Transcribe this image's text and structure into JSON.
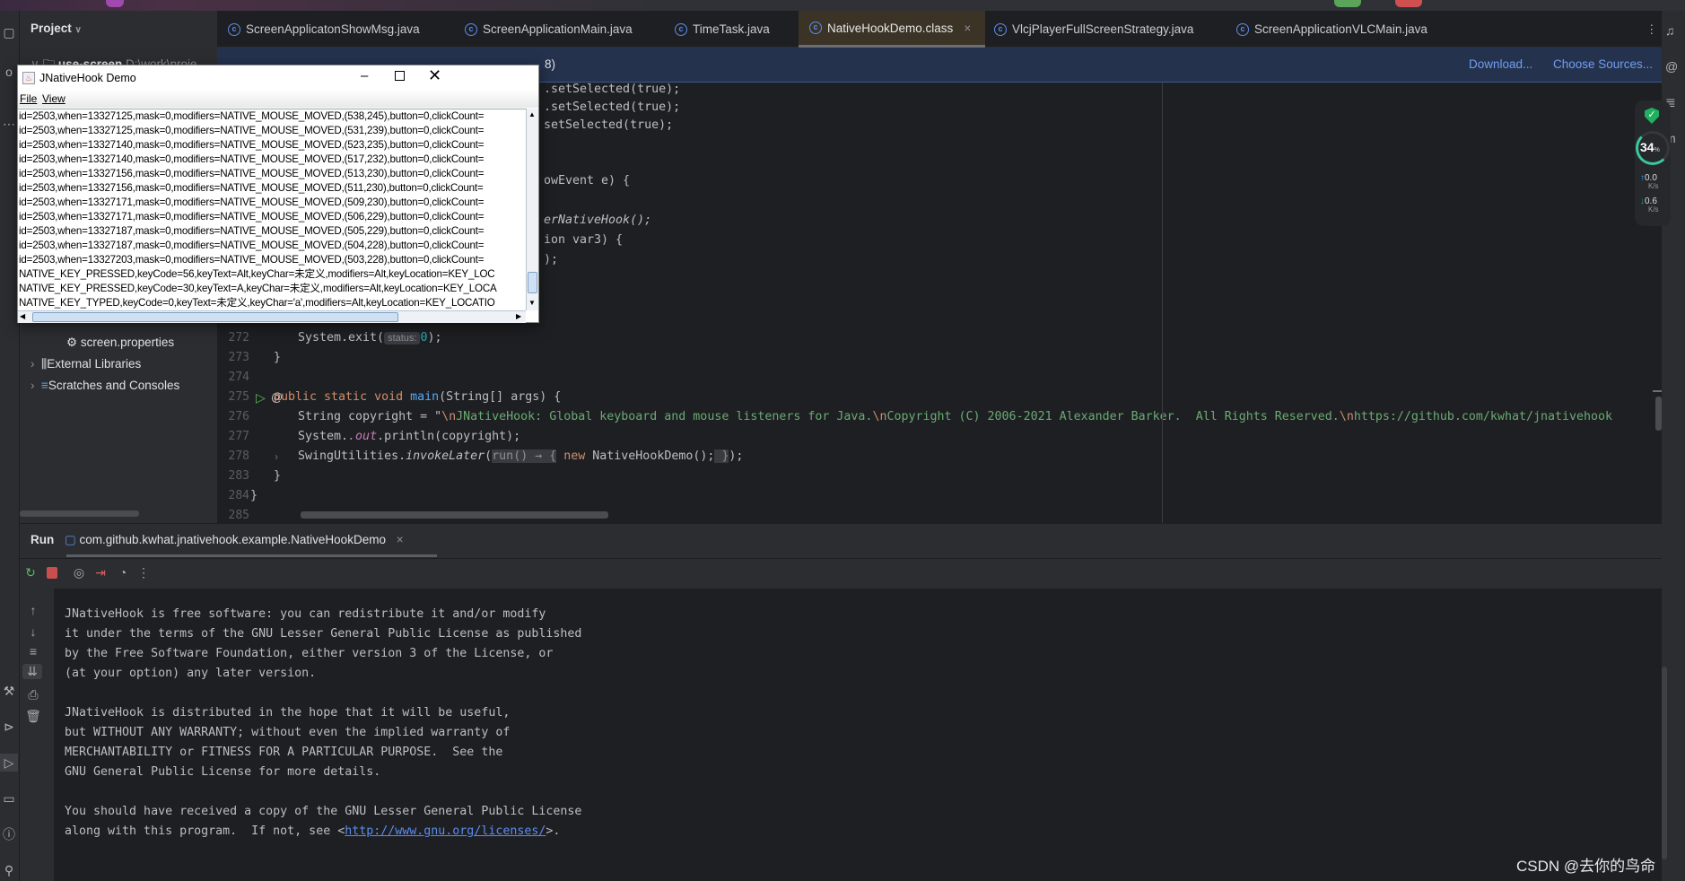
{
  "window": {
    "accent": "#5b8def",
    "editor_bg": "#1e1f22",
    "panel_bg": "#2b2d30"
  },
  "project": {
    "header": "Project",
    "tree": [
      {
        "label": "use-screen",
        "extra": "D:\\work\\proje"
      },
      {
        "label": "screen.properties",
        "icon": "gear-icon"
      },
      {
        "label": "External Libraries",
        "icon": "library-icon"
      },
      {
        "label": "Scratches and Consoles",
        "icon": "scratches-icon"
      }
    ]
  },
  "tabs": [
    {
      "label": "ScreenApplicatonShowMsg.java"
    },
    {
      "label": "ScreenApplicationMain.java"
    },
    {
      "label": "TimeTask.java"
    },
    {
      "label": "NativeHookDemo.class",
      "active": true
    },
    {
      "label": "VlcjPlayerFullScreenStrategy.java"
    },
    {
      "label": "ScreenApplicationVLCMain.java"
    }
  ],
  "notification": {
    "text": "8)",
    "download": "Download...",
    "choose_sources": "Choose Sources..."
  },
  "editor": {
    "partial": [
      ".setSelected(true);",
      ".setSelected(true);",
      "setSelected(true);",
      "owEvent e) {",
      "erNativeHook();",
      "ion var3) {",
      ");"
    ],
    "lines": [
      {
        "n": "272",
        "parts": [
          "System.exit(",
          "status:",
          "0",
          ");"
        ]
      },
      {
        "n": "273",
        "text": "}"
      },
      {
        "n": "274",
        "text": ""
      },
      {
        "n": "275",
        "parts": [
          "public static void ",
          "main",
          "(String[] args) {"
        ]
      },
      {
        "n": "276",
        "parts": [
          "String copyright = \"",
          "\\n",
          "JNativeHook: Global keyboard and mouse listeners for Java.",
          "\\n",
          "Copyright (C) 2006-2021 Alexander Barker.  All Rights Reserved.",
          "\\n",
          "https://github.com/kwhat/jnativehook"
        ]
      },
      {
        "n": "277",
        "parts": [
          "System.",
          ".out",
          ".println(copyright);"
        ]
      },
      {
        "n": "278",
        "parts": [
          "SwingUtilities.",
          "invokeLater",
          "(",
          "run() → {",
          " new",
          " NativeHookDemo();",
          " }",
          ");"
        ]
      },
      {
        "n": "283",
        "text": "}"
      },
      {
        "n": "284",
        "text": "}"
      },
      {
        "n": "285",
        "text": ""
      }
    ]
  },
  "widget": {
    "cpu_percent": 34,
    "percent_sign": "%",
    "upload": "0.0",
    "download": "0.6",
    "unit": "K/s"
  },
  "run": {
    "title": "Run",
    "tab": "com.github.kwhat.jnativehook.example.NativeHookDemo",
    "console": [
      "JNativeHook is free software: you can redistribute it and/or modify",
      "it under the terms of the GNU Lesser General Public License as published",
      "by the Free Software Foundation, either version 3 of the License, or",
      "(at your option) any later version.",
      "",
      "JNativeHook is distributed in the hope that it will be useful,",
      "but WITHOUT ANY WARRANTY; without even the implied warranty of",
      "MERCHANTABILITY or FITNESS FOR A PARTICULAR PURPOSE.  See the",
      "GNU General Public License for more details.",
      "",
      "You should have received a copy of the GNU Lesser General Public License"
    ],
    "last_line_prefix": "along with this program.  If not, see <",
    "last_line_link": "http://www.gnu.org/licenses/",
    "last_line_suffix": ">."
  },
  "dialog": {
    "title": "JNativeHook Demo",
    "menu": [
      "File",
      "View"
    ],
    "rows": [
      "id=2503,when=13327125,mask=0,modifiers=NATIVE_MOUSE_MOVED,(538,245),button=0,clickCount=",
      "id=2503,when=13327125,mask=0,modifiers=NATIVE_MOUSE_MOVED,(531,239),button=0,clickCount=",
      "id=2503,when=13327140,mask=0,modifiers=NATIVE_MOUSE_MOVED,(523,235),button=0,clickCount=",
      "id=2503,when=13327140,mask=0,modifiers=NATIVE_MOUSE_MOVED,(517,232),button=0,clickCount=",
      "id=2503,when=13327156,mask=0,modifiers=NATIVE_MOUSE_MOVED,(513,230),button=0,clickCount=",
      "id=2503,when=13327156,mask=0,modifiers=NATIVE_MOUSE_MOVED,(511,230),button=0,clickCount=",
      "id=2503,when=13327171,mask=0,modifiers=NATIVE_MOUSE_MOVED,(509,230),button=0,clickCount=",
      "id=2503,when=13327171,mask=0,modifiers=NATIVE_MOUSE_MOVED,(506,229),button=0,clickCount=",
      "id=2503,when=13327187,mask=0,modifiers=NATIVE_MOUSE_MOVED,(505,229),button=0,clickCount=",
      "id=2503,when=13327187,mask=0,modifiers=NATIVE_MOUSE_MOVED,(504,228),button=0,clickCount=",
      "id=2503,when=13327203,mask=0,modifiers=NATIVE_MOUSE_MOVED,(503,228),button=0,clickCount=",
      "NATIVE_KEY_PRESSED,keyCode=56,keyText=Alt,keyChar=未定义,modifiers=Alt,keyLocation=KEY_LOC",
      "NATIVE_KEY_PRESSED,keyCode=30,keyText=A,keyChar=未定义,modifiers=Alt,keyLocation=KEY_LOCA",
      "NATIVE_KEY_TYPED,keyCode=0,keyText=未定义,keyChar='a',modifiers=Alt,keyLocation=KEY_LOCATIO"
    ]
  },
  "watermark": "CSDN @去你的鸟命"
}
